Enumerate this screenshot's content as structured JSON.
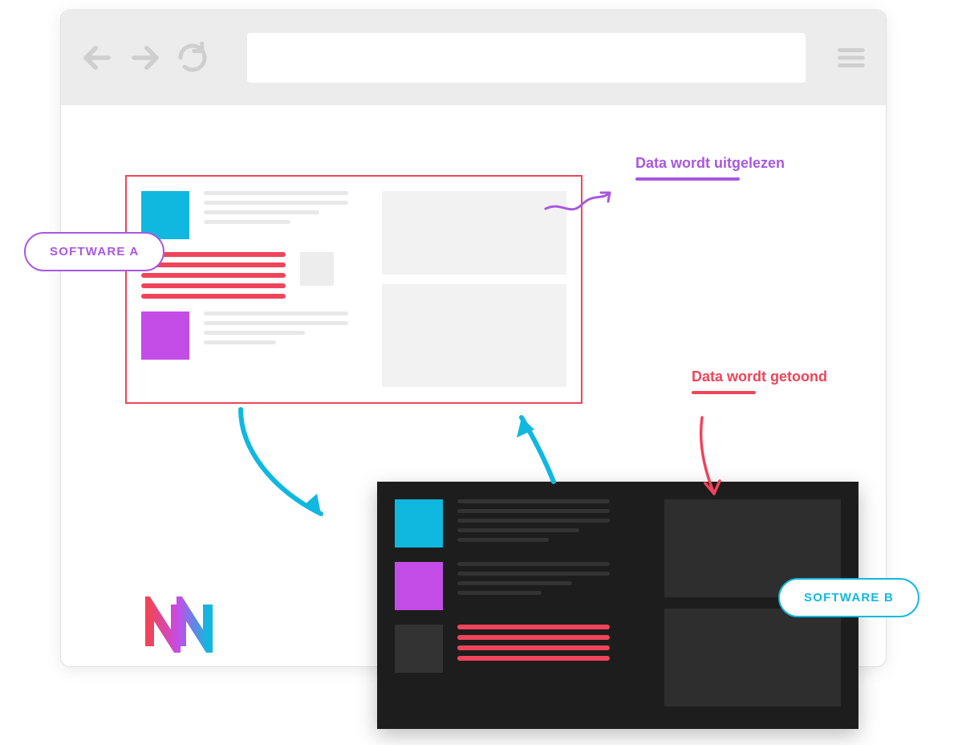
{
  "labels": {
    "software_a": "SOFTWARE A",
    "software_b": "SOFTWARE B"
  },
  "annotations": {
    "read": "Data wordt uitgelezen",
    "show": "Data wordt getoond"
  },
  "colors": {
    "red": "#f0445a",
    "cyan": "#10b8e0",
    "purple": "#a858e0",
    "magenta": "#c44de8",
    "dark": "#1d1d1d"
  }
}
